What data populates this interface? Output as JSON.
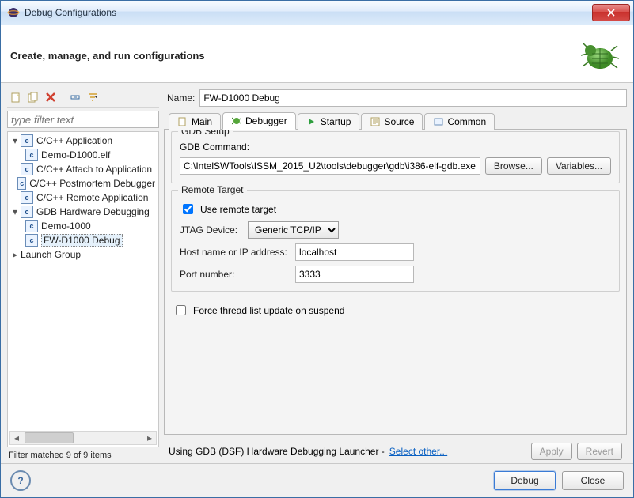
{
  "title": "Debug Configurations",
  "header": "Create, manage, and run configurations",
  "filter_placeholder": "type filter text",
  "tree": {
    "items": [
      {
        "label": "C/C++ Application",
        "children": [
          {
            "label": "Demo-D1000.elf"
          }
        ]
      },
      {
        "label": "C/C++ Attach to Application"
      },
      {
        "label": "C/C++ Postmortem Debugger"
      },
      {
        "label": "C/C++ Remote Application"
      },
      {
        "label": "GDB Hardware Debugging",
        "children": [
          {
            "label": "Demo-1000"
          },
          {
            "label": "FW-D1000 Debug",
            "selected": true
          }
        ]
      },
      {
        "label": "Launch Group"
      }
    ]
  },
  "filter_status": "Filter matched 9 of 9 items",
  "name_label": "Name:",
  "name_value": "FW-D1000 Debug",
  "tabs": {
    "main": "Main",
    "debugger": "Debugger",
    "startup": "Startup",
    "source": "Source",
    "common": "Common"
  },
  "gdb_setup": {
    "title": "GDB Setup",
    "command_label": "GDB Command:",
    "command_value": "C:\\IntelSWTools\\ISSM_2015_U2\\tools\\debugger\\gdb\\i386-elf-gdb.exe",
    "browse": "Browse...",
    "variables": "Variables..."
  },
  "remote": {
    "title": "Remote Target",
    "use_remote_label": "Use remote target",
    "use_remote_checked": true,
    "jtag_label": "JTAG Device:",
    "jtag_value": "Generic TCP/IP",
    "host_label": "Host name or IP address:",
    "host_value": "localhost",
    "port_label": "Port number:",
    "port_value": "3333"
  },
  "force_thread_label": "Force thread list update on suspend",
  "force_thread_checked": false,
  "launcher_text": "Using GDB (DSF) Hardware Debugging Launcher - ",
  "launcher_link": "Select other...",
  "apply": "Apply",
  "revert": "Revert",
  "debug": "Debug",
  "close": "Close"
}
